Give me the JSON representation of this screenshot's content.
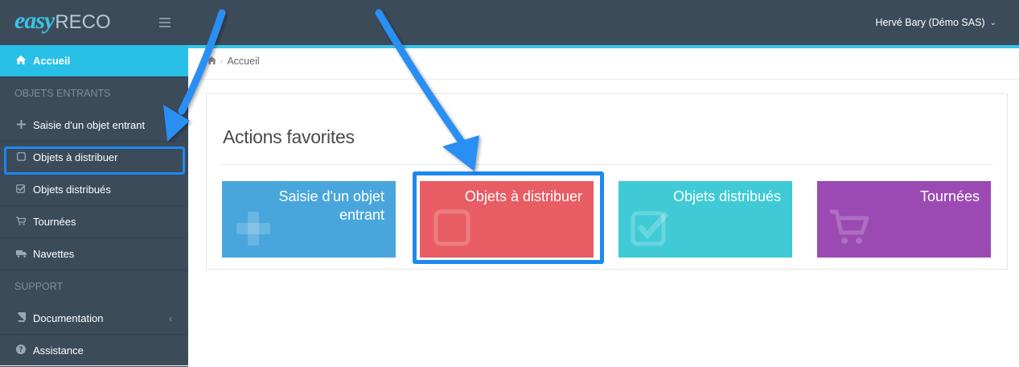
{
  "app": {
    "logo_part1": "easy",
    "logo_part2": "RECO"
  },
  "header": {
    "user_name": "Hervé Bary (Démo SAS)",
    "user_caret": "⌄"
  },
  "sidebar": {
    "items": [
      {
        "label": "Accueil",
        "icon": "home-icon"
      },
      {
        "label": "OBJETS ENTRANTS",
        "type": "header"
      },
      {
        "label": "Saisie d'un objet entrant",
        "icon": "plus-icon"
      },
      {
        "label": "Objets à distribuer",
        "icon": "square-icon"
      },
      {
        "label": "Objets distribués",
        "icon": "check-square-icon"
      },
      {
        "label": "Tournées",
        "icon": "cart-icon"
      },
      {
        "label": "Navettes",
        "icon": "truck-icon"
      },
      {
        "label": "SUPPORT",
        "type": "header"
      },
      {
        "label": "Documentation",
        "icon": "book-icon",
        "chevron": "‹"
      },
      {
        "label": "Assistance",
        "icon": "help-icon"
      }
    ]
  },
  "breadcrumb": {
    "current": "Accueil",
    "separator": "›"
  },
  "main": {
    "panel_title": "Actions favorites",
    "tiles": [
      {
        "label_line1": "Saisie d'un objet",
        "label_line2": "entrant",
        "color": "#48a6dc",
        "icon": "plus-icon"
      },
      {
        "label_line1": "Objets à distribuer",
        "label_line2": "",
        "color": "#e85d64",
        "icon": "square-icon"
      },
      {
        "label_line1": "Objets distribués",
        "label_line2": "",
        "color": "#3fcad6",
        "icon": "check-square-icon"
      },
      {
        "label_line1": "Tournées",
        "label_line2": "",
        "color": "#9a4ab2",
        "icon": "cart-icon"
      }
    ]
  },
  "colors": {
    "topbar": "#3c4b5a",
    "accent": "#29c0e8",
    "highlight": "#1e88f0"
  }
}
